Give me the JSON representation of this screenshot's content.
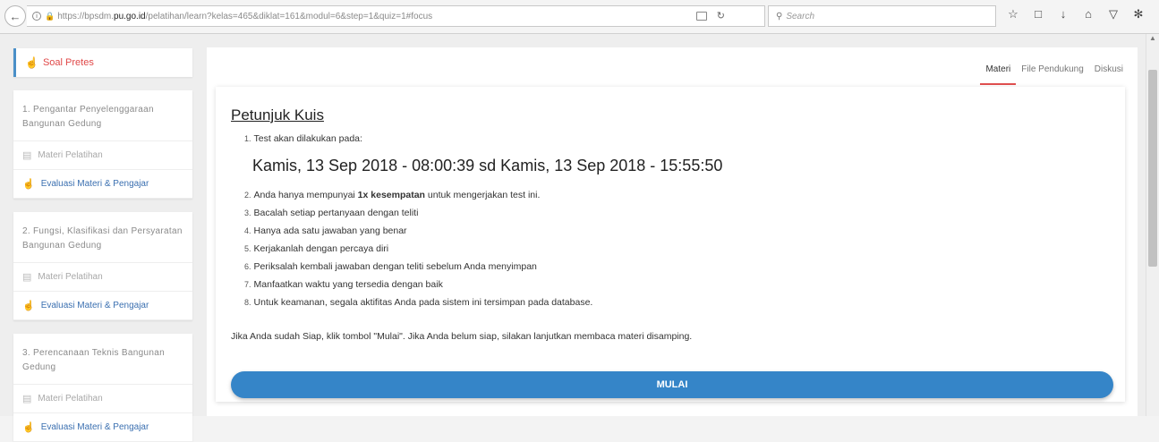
{
  "browser": {
    "url_prefix": "https://bpsdm.",
    "url_host": "pu.go.id",
    "url_path": "/pelatihan/learn?kelas=465&diklat=161&modul=6&step=1&quiz=1#focus",
    "search_placeholder": "Search",
    "toolbar_icons": [
      "star-icon",
      "clipboard-icon",
      "download-icon",
      "home-icon",
      "pocket-icon",
      "extension-icon",
      "menu-icon"
    ]
  },
  "sidebar": {
    "pretes_label": "Soal Pretes",
    "modules": [
      {
        "title": "1. Pengantar Penyelenggaraan Bangunan Gedung",
        "materi": "Materi Pelatihan",
        "evaluasi": "Evaluasi Materi & Pengajar"
      },
      {
        "title": "2. Fungsi, Klasifikasi dan Persyaratan Bangunan Gedung",
        "materi": "Materi Pelatihan",
        "evaluasi": "Evaluasi Materi & Pengajar"
      },
      {
        "title": "3. Perencanaan Teknis Bangunan Gedung",
        "materi": "Materi Pelatihan",
        "evaluasi": "Evaluasi Materi & Pengajar"
      }
    ]
  },
  "tabs": [
    {
      "label": "Materi",
      "active": true
    },
    {
      "label": "File Pendukung",
      "active": false
    },
    {
      "label": "Diskusi",
      "active": false
    }
  ],
  "quiz": {
    "heading": "Petunjuk Kuis",
    "item1": "Test akan dilakukan pada:",
    "schedule": "Kamis, 13 Sep 2018 - 08:00:39 sd Kamis, 13 Sep 2018 - 15:55:50",
    "item2_before": "Anda hanya mempunyai ",
    "item2_bold": "1x kesempatan",
    "item2_after": " untuk mengerjakan test ini.",
    "items": [
      "Bacalah setiap pertanyaan dengan teliti",
      "Hanya ada satu jawaban yang benar",
      "Kerjakanlah dengan percaya diri",
      "Periksalah kembali jawaban dengan teliti sebelum Anda menyimpan",
      "Manfaatkan waktu yang tersedia dengan baik",
      "Untuk keamanan, segala aktifitas Anda pada sistem ini tersimpan pada database."
    ],
    "note": "Jika Anda sudah Siap, klik tombol \"Mulai\". Jika Anda belum siap, silakan lanjutkan membaca materi disamping.",
    "start_label": "MULAI"
  },
  "colors": {
    "accent": "#3585c8",
    "tab_underline": "#e05050",
    "pretes": "#e04848",
    "eval_link": "#3a6fb0"
  }
}
